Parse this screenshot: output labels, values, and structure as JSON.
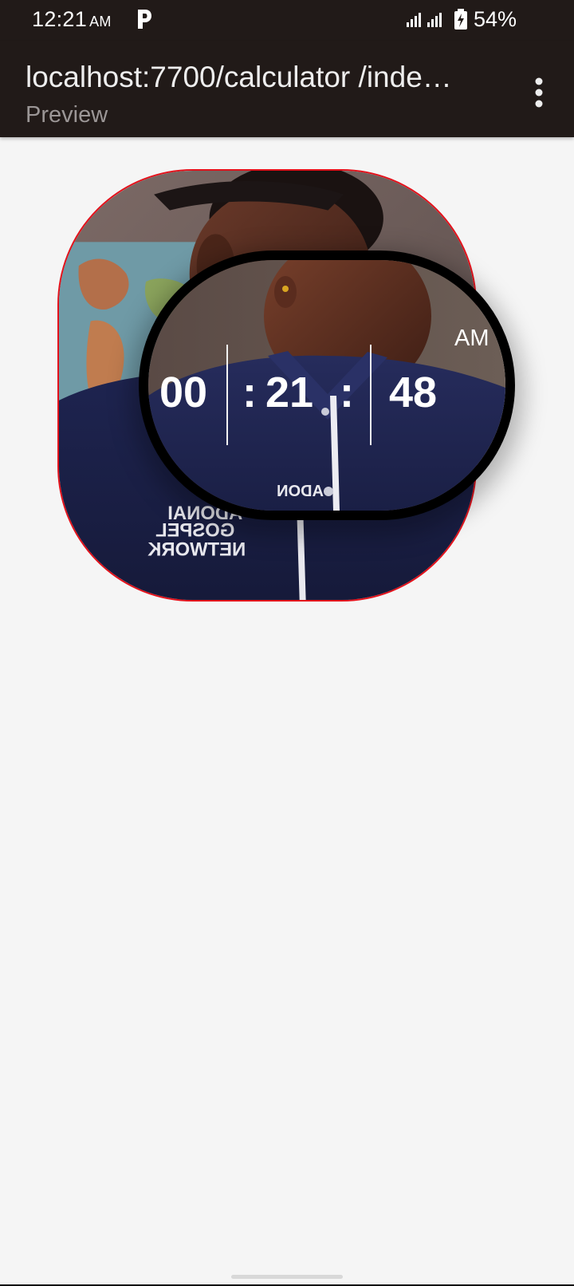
{
  "status_bar": {
    "time": "12:21",
    "ampm": "AM",
    "app_icon": "p-icon",
    "signal_icon": "signal-icon",
    "battery_icon": "battery-charging-icon",
    "battery": "54%"
  },
  "app_bar": {
    "title": "localhost:7700/calculator /inde…",
    "subtitle": "Preview",
    "menu_icon": "more-vert-icon"
  },
  "photo": {
    "description_icon": "photo-image",
    "shirt_text": [
      "ADONAI",
      "GOSPEL",
      "NETWORK"
    ],
    "badge_text": "ADON",
    "border_color": "#e4111b"
  },
  "clock": {
    "hours": "00",
    "sep1": ":",
    "minutes": "21",
    "sep2": ":",
    "seconds": "48",
    "ampm": "AM"
  },
  "colors": {
    "bar_background": "#211a18",
    "page_background": "#f5f5f5",
    "clock_border": "#000000",
    "clock_text": "#ffffff"
  }
}
